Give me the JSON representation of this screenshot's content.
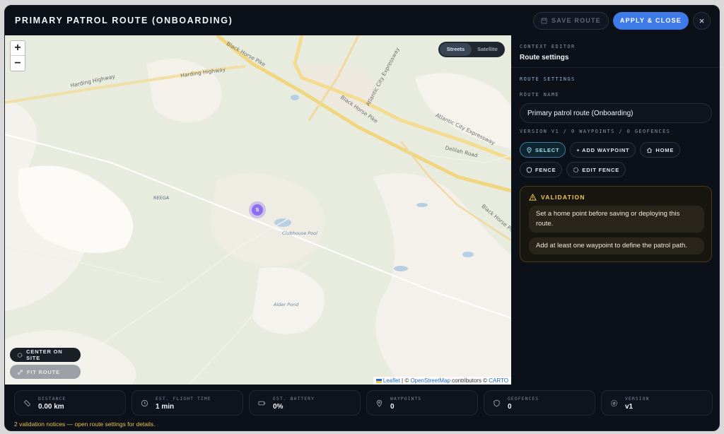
{
  "header": {
    "title": "PRIMARY PATROL ROUTE (ONBOARDING)",
    "save_label": "SAVE ROUTE",
    "apply_label": "APPLY & CLOSE",
    "close_icon": "×"
  },
  "map": {
    "zoom_in": "+",
    "zoom_out": "−",
    "layers": {
      "streets": "Streets",
      "satellite": "Satellite",
      "active": "Streets"
    },
    "labels": {
      "harding_highway_1": "Harding Highway",
      "harding_highway_2": "Harding Highway",
      "black_horse_pike_1": "Black Horse Pike",
      "black_horse_pike_2": "Black Horse Pike",
      "black_horse_pike_3": "Black Horse Pike",
      "atlantic_city_expressway_1": "Atlantic City Expressway",
      "atlantic_city_expressway_2": "Atlantic City Expressway",
      "delilah_road": "Delilah Road",
      "reega": "REEGA",
      "clubhouse_pool": "Clubhouse Pool",
      "alder_pond": "Alder Pond"
    },
    "marker_label": "S",
    "center_on_site": "CENTER ON SITE",
    "fit_route": "FIT ROUTE",
    "attribution": {
      "leaflet": "Leaflet",
      "sep": " | © ",
      "osm": "OpenStreetMap",
      "contributors": " contributors © ",
      "carto": "CARTO"
    }
  },
  "panel": {
    "context_kicker": "CONTEXT EDITOR",
    "context_title": "Route settings",
    "section_kicker": "ROUTE SETTINGS",
    "route_name_label": "ROUTE NAME",
    "route_name_value": "Primary patrol route (Onboarding)",
    "meta": "VERSION V1 / 0 WAYPOINTS / 0 GEOFENCES",
    "tools": {
      "select": "SELECT",
      "add_waypoint": "+ ADD WAYPOINT",
      "home": "HOME",
      "fence": "FENCE",
      "edit_fence": "EDIT FENCE"
    },
    "validation": {
      "title": "VALIDATION",
      "items": [
        "Set a home point before saving or deploying this route.",
        "Add at least one waypoint to define the patrol path."
      ]
    }
  },
  "footer": {
    "stats": [
      {
        "key": "DISTANCE",
        "value": "0.00 km",
        "icon": "ruler-icon"
      },
      {
        "key": "EST. FLIGHT TIME",
        "value": "1 min",
        "icon": "clock-icon"
      },
      {
        "key": "EST. BATTERY",
        "value": "0%",
        "icon": "battery-icon"
      },
      {
        "key": "WAYPOINTS",
        "value": "0",
        "icon": "pin-icon"
      },
      {
        "key": "GEOFENCES",
        "value": "0",
        "icon": "shield-icon"
      },
      {
        "key": "VERSION",
        "value": "v1",
        "icon": "gear-icon"
      }
    ],
    "notice": "2 validation notices — open route settings for details."
  },
  "colors": {
    "accent": "#3f7be8",
    "warning": "#f4c74a",
    "marker": "#8b6ff0",
    "background": "#0c1119"
  }
}
